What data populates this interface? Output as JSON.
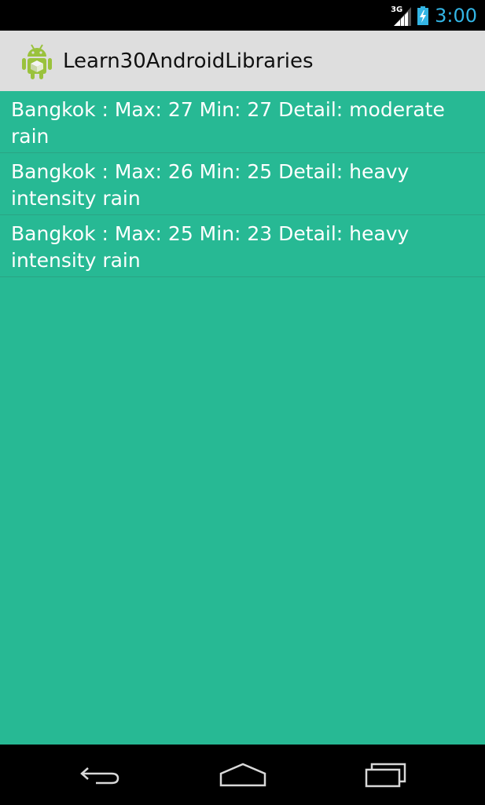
{
  "status_bar": {
    "network_type": "3G",
    "time": "3:00",
    "icons": [
      "signal-icon",
      "battery-charging-icon"
    ]
  },
  "action_bar": {
    "app_icon": "android-app-icon",
    "title": "Learn30AndroidLibraries"
  },
  "list": {
    "items": [
      {
        "text": "Bangkok : Max: 27 Min: 27 Detail: moderate rain"
      },
      {
        "text": "Bangkok : Max: 26 Min: 25 Detail: heavy intensity rain"
      },
      {
        "text": "Bangkok : Max: 25 Min: 23 Detail: heavy intensity rain"
      }
    ]
  },
  "nav_bar": {
    "buttons": [
      "back-icon",
      "home-icon",
      "recent-apps-icon"
    ]
  },
  "colors": {
    "status_clock": "#33b5e5",
    "action_bar_bg": "#dedede",
    "content_bg": "#27b994",
    "divider": "#2aa484"
  }
}
